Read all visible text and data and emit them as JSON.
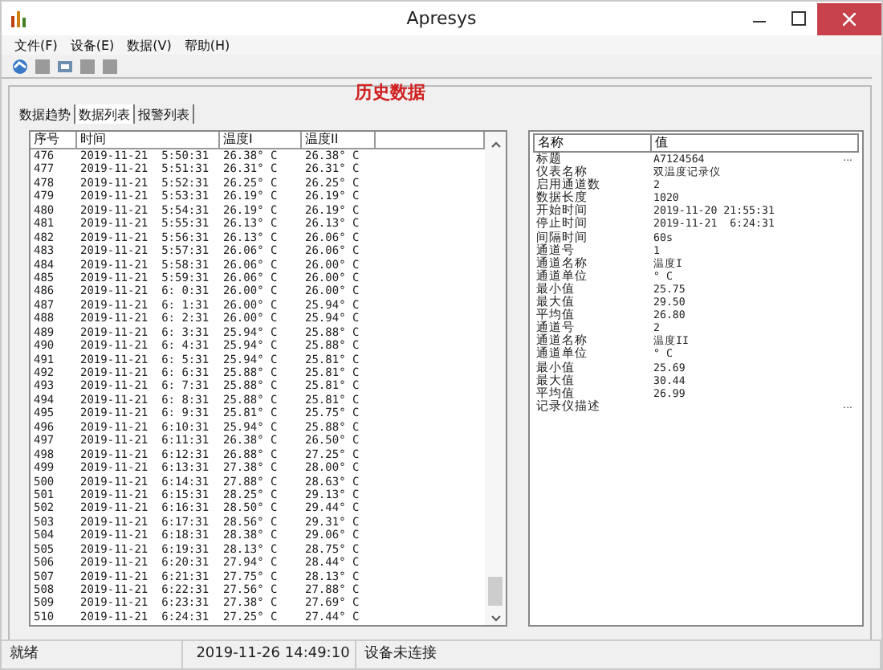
{
  "window": {
    "title": "Apresys"
  },
  "menu": [
    "文件(F)",
    "设备(E)",
    "数据(V)",
    "帮助(H)"
  ],
  "heading": "历史数据",
  "tabs": [
    {
      "label": "数据趋势",
      "selected": false
    },
    {
      "label": "数据列表",
      "selected": true
    },
    {
      "label": "报警列表",
      "selected": false
    }
  ],
  "table": {
    "columns": [
      "序号",
      "时间",
      "温度I",
      "温度II"
    ],
    "rows": [
      [
        "476",
        "2019-11-21  5:50:31",
        "26.38° C",
        "26.38° C"
      ],
      [
        "477",
        "2019-11-21  5:51:31",
        "26.31° C",
        "26.31° C"
      ],
      [
        "478",
        "2019-11-21  5:52:31",
        "26.25° C",
        "26.25° C"
      ],
      [
        "479",
        "2019-11-21  5:53:31",
        "26.19° C",
        "26.19° C"
      ],
      [
        "480",
        "2019-11-21  5:54:31",
        "26.19° C",
        "26.19° C"
      ],
      [
        "481",
        "2019-11-21  5:55:31",
        "26.13° C",
        "26.13° C"
      ],
      [
        "482",
        "2019-11-21  5:56:31",
        "26.13° C",
        "26.06° C"
      ],
      [
        "483",
        "2019-11-21  5:57:31",
        "26.06° C",
        "26.06° C"
      ],
      [
        "484",
        "2019-11-21  5:58:31",
        "26.06° C",
        "26.00° C"
      ],
      [
        "485",
        "2019-11-21  5:59:31",
        "26.06° C",
        "26.00° C"
      ],
      [
        "486",
        "2019-11-21  6: 0:31",
        "26.00° C",
        "26.00° C"
      ],
      [
        "487",
        "2019-11-21  6: 1:31",
        "26.00° C",
        "25.94° C"
      ],
      [
        "488",
        "2019-11-21  6: 2:31",
        "26.00° C",
        "25.94° C"
      ],
      [
        "489",
        "2019-11-21  6: 3:31",
        "25.94° C",
        "25.88° C"
      ],
      [
        "490",
        "2019-11-21  6: 4:31",
        "25.94° C",
        "25.88° C"
      ],
      [
        "491",
        "2019-11-21  6: 5:31",
        "25.94° C",
        "25.81° C"
      ],
      [
        "492",
        "2019-11-21  6: 6:31",
        "25.88° C",
        "25.81° C"
      ],
      [
        "493",
        "2019-11-21  6: 7:31",
        "25.88° C",
        "25.81° C"
      ],
      [
        "494",
        "2019-11-21  6: 8:31",
        "25.88° C",
        "25.81° C"
      ],
      [
        "495",
        "2019-11-21  6: 9:31",
        "25.81° C",
        "25.75° C"
      ],
      [
        "496",
        "2019-11-21  6:10:31",
        "25.94° C",
        "25.88° C"
      ],
      [
        "497",
        "2019-11-21  6:11:31",
        "26.38° C",
        "26.50° C"
      ],
      [
        "498",
        "2019-11-21  6:12:31",
        "26.88° C",
        "27.25° C"
      ],
      [
        "499",
        "2019-11-21  6:13:31",
        "27.38° C",
        "28.00° C"
      ],
      [
        "500",
        "2019-11-21  6:14:31",
        "27.88° C",
        "28.63° C"
      ],
      [
        "501",
        "2019-11-21  6:15:31",
        "28.25° C",
        "29.13° C"
      ],
      [
        "502",
        "2019-11-21  6:16:31",
        "28.50° C",
        "29.44° C"
      ],
      [
        "503",
        "2019-11-21  6:17:31",
        "28.56° C",
        "29.31° C"
      ],
      [
        "504",
        "2019-11-21  6:18:31",
        "28.38° C",
        "29.06° C"
      ],
      [
        "505",
        "2019-11-21  6:19:31",
        "28.13° C",
        "28.75° C"
      ],
      [
        "506",
        "2019-11-21  6:20:31",
        "27.94° C",
        "28.44° C"
      ],
      [
        "507",
        "2019-11-21  6:21:31",
        "27.75° C",
        "28.13° C"
      ],
      [
        "508",
        "2019-11-21  6:22:31",
        "27.56° C",
        "27.88° C"
      ],
      [
        "509",
        "2019-11-21  6:23:31",
        "27.38° C",
        "27.69° C"
      ],
      [
        "510",
        "2019-11-21  6:24:31",
        "27.25° C",
        "27.44° C"
      ]
    ]
  },
  "properties": {
    "columns": [
      "名称",
      "值"
    ],
    "rows": [
      {
        "name": "标题",
        "value": "A7124564",
        "more": "..."
      },
      {
        "name": "仪表名称",
        "value": "双温度记录仪"
      },
      {
        "name": "启用通道数",
        "value": "2"
      },
      {
        "name": "数据长度",
        "value": "1020"
      },
      {
        "name": "开始时间",
        "value": "2019-11-20 21:55:31"
      },
      {
        "name": "停止时间",
        "value": "2019-11-21  6:24:31"
      },
      {
        "name": "间隔时间",
        "value": "60s"
      },
      {
        "name": "通道号",
        "value": "1"
      },
      {
        "name": "通道名称",
        "value": "温度I"
      },
      {
        "name": "通道单位",
        "value": "° C"
      },
      {
        "name": "最小值",
        "value": "25.75"
      },
      {
        "name": "最大值",
        "value": "29.50"
      },
      {
        "name": "平均值",
        "value": "26.80"
      },
      {
        "name": "通道号",
        "value": "2"
      },
      {
        "name": "通道名称",
        "value": "温度II"
      },
      {
        "name": "通道单位",
        "value": "° C"
      },
      {
        "name": "最小值",
        "value": "25.69"
      },
      {
        "name": "最大值",
        "value": "30.44"
      },
      {
        "name": "平均值",
        "value": "26.99"
      },
      {
        "name": "记录仪描述",
        "value": "",
        "more": "..."
      }
    ]
  },
  "status_bar": [
    "就绪",
    "2019-11-26 14:49:10",
    "设备未连接"
  ]
}
